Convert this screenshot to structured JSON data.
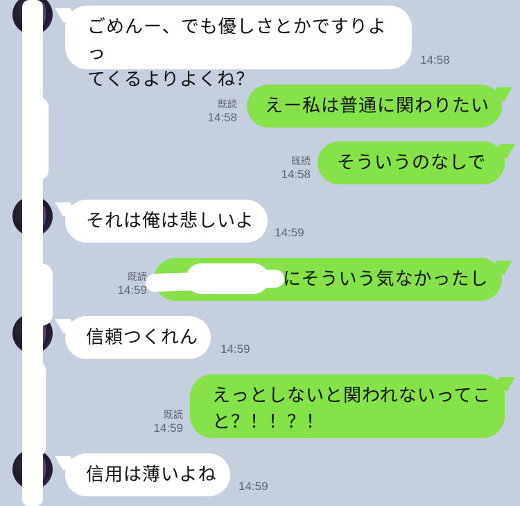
{
  "read_label": "既読",
  "messages": [
    {
      "side": "left",
      "text": "ごめんー、でも優しさとかですりよってくるよりよくね？",
      "line1": "ごめんー、でも優しさとかですりよっ",
      "line2": "てくるよりよくね？",
      "time": "14:58"
    },
    {
      "side": "right",
      "text": "えー私は普通に関わりたい",
      "time": "14:58",
      "read": "既読"
    },
    {
      "side": "right",
      "text": "そういうのなしで",
      "time": "14:58",
      "read": "既読"
    },
    {
      "side": "left",
      "text": "それは俺は悲しいよ",
      "time": "14:59"
    },
    {
      "side": "right",
      "text": "にそういう気なかったし",
      "time": "14:59",
      "read": "既読"
    },
    {
      "side": "left",
      "text": "信頼つくれん",
      "time": "14:59"
    },
    {
      "side": "right",
      "line1": "えっとしないと関われないってこ",
      "line2": "と？！！？！",
      "time": "14:59",
      "read": "既読"
    },
    {
      "side": "left",
      "text": "信用は薄いよね",
      "time": "14:59"
    }
  ]
}
